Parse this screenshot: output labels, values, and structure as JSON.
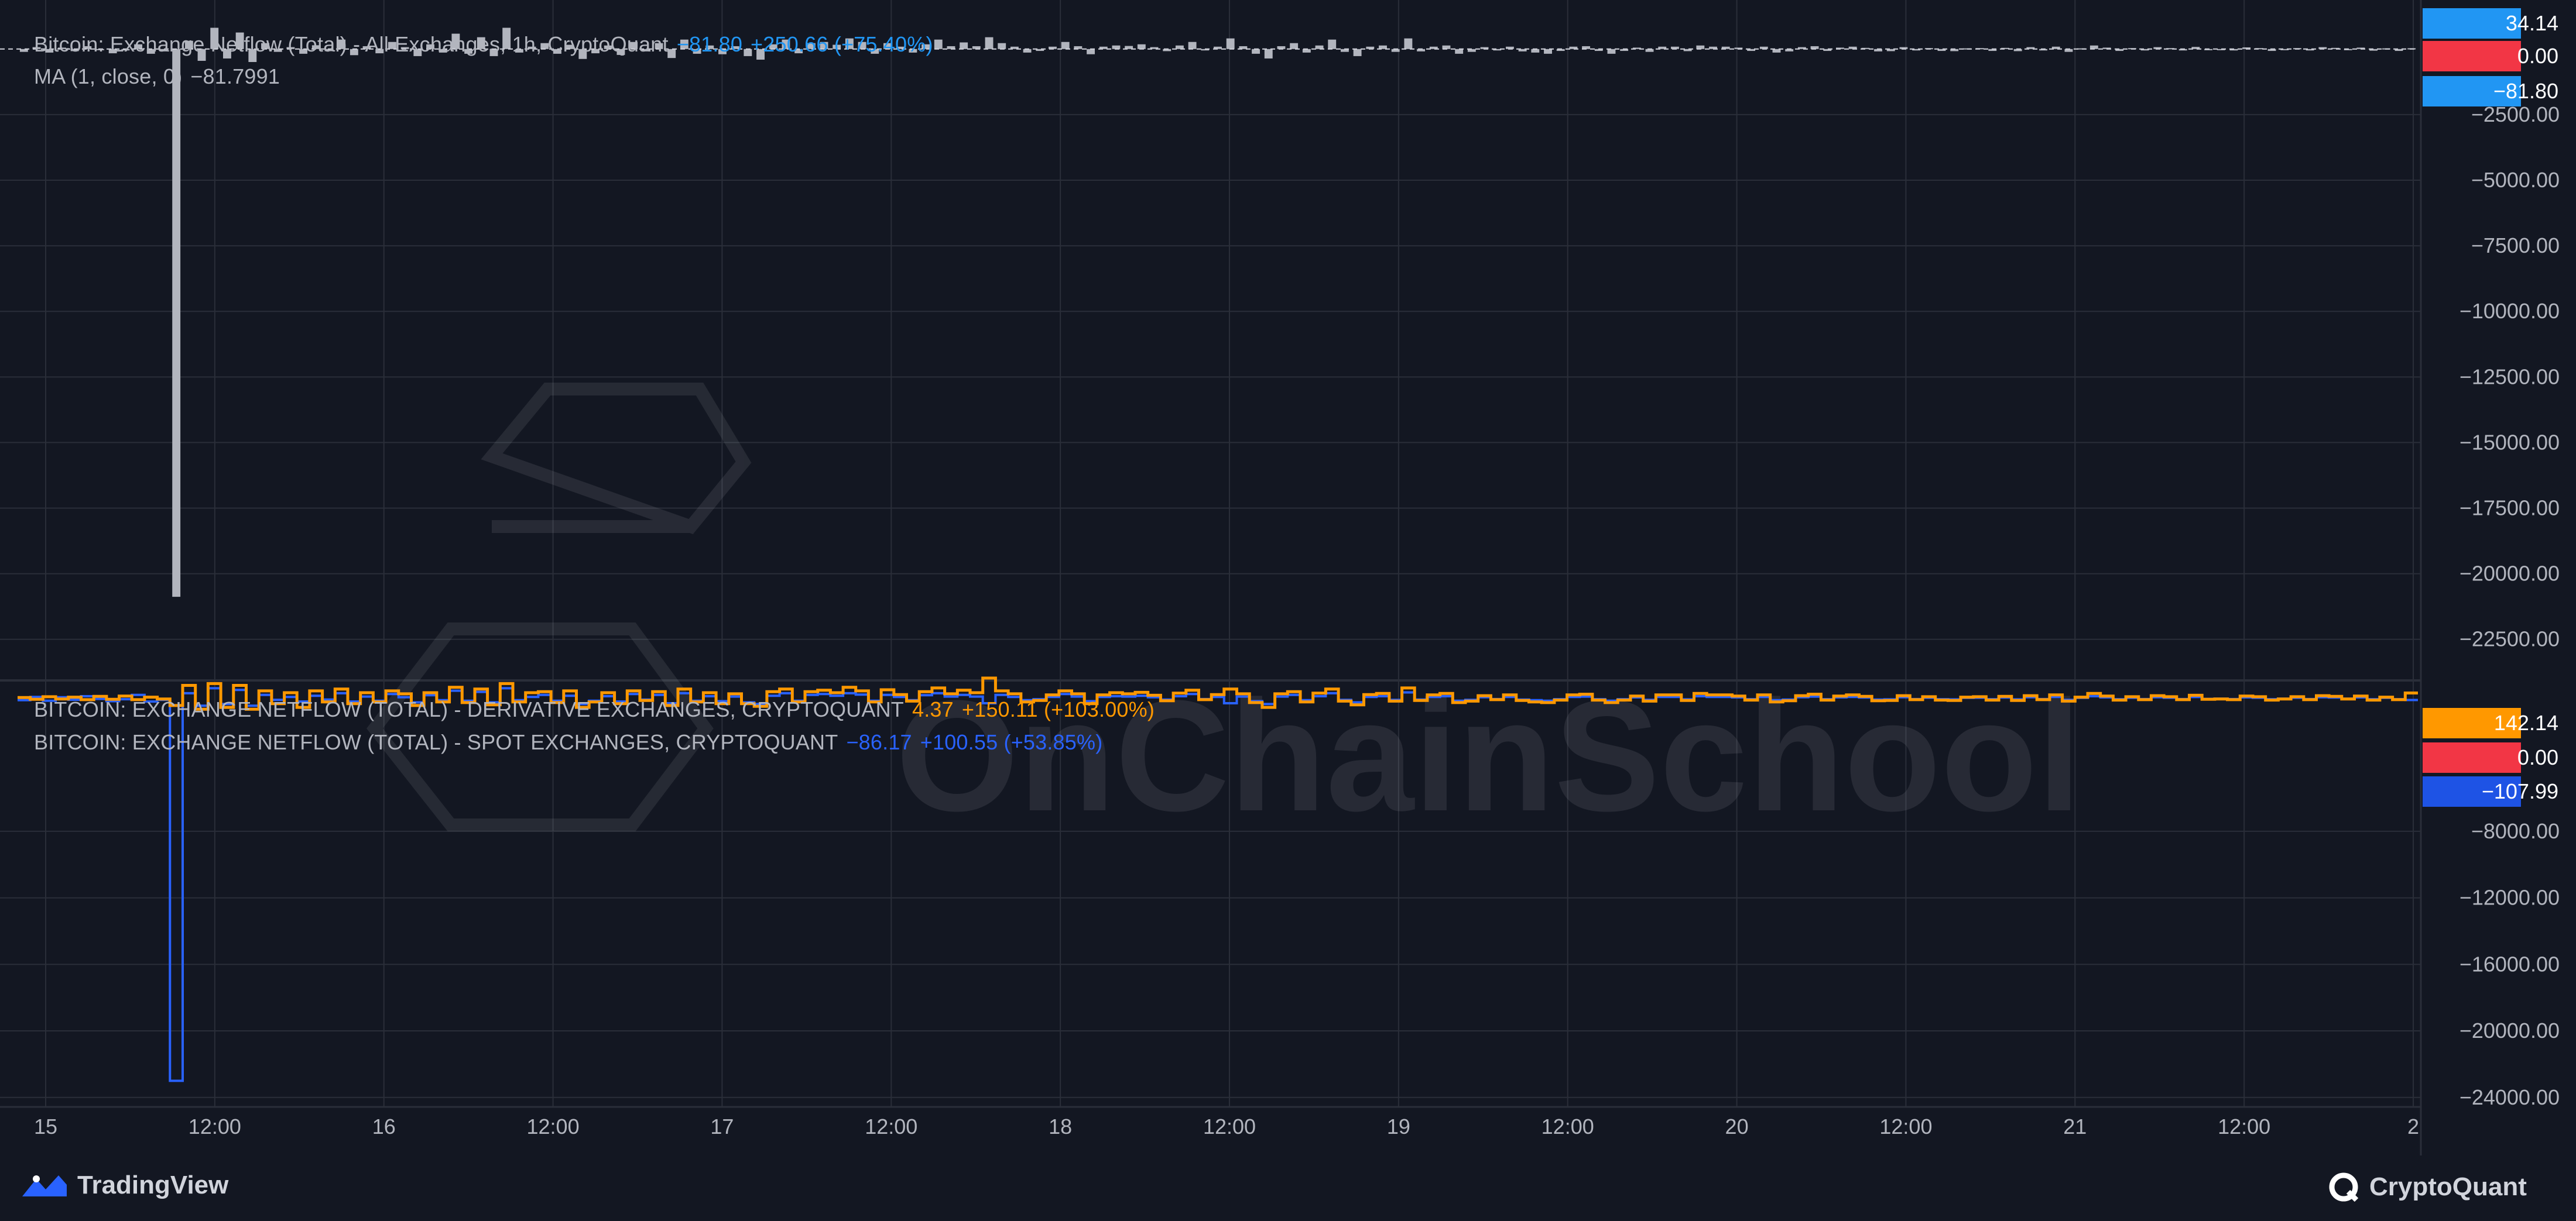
{
  "header": {
    "main_title": "Bitcoin: Exchange Netflow (Total) - All Exchanges, 1h, CryptoQuant",
    "main_last": "−81.80",
    "main_change": "+250.66 (+75.40%)",
    "ma_label": "MA (1, close, 0)",
    "ma_value": "−81.7991"
  },
  "sub_legend": {
    "derivative_title": "BITCOIN: EXCHANGE NETFLOW (TOTAL) - DERIVATIVE EXCHANGES, CRYPTOQUANT",
    "derivative_last": "4.37",
    "derivative_change": "+150.11 (+103.00%)",
    "spot_title": "BITCOIN: EXCHANGE NETFLOW (TOTAL) - SPOT EXCHANGES, CRYPTOQUANT",
    "spot_last": "−86.17",
    "spot_change": "+100.55 (+53.85%)"
  },
  "watermark": "OnChainSchool",
  "footer": {
    "left_brand": "TradingView",
    "right_brand": "CryptoQuant"
  },
  "colors": {
    "background": "#131722",
    "grid": "#2a2e39",
    "bars": "#b2b5be",
    "spot": "#2962ff",
    "derivative": "#ff9800",
    "red_tag": "#f23645",
    "blue_tag": "#2196f3"
  },
  "chart_data": [
    {
      "type": "bar",
      "title": "Bitcoin: Exchange Netflow (Total) - All Exchanges, 1h, CryptoQuant",
      "ylim": [
        -24000,
        1200
      ],
      "y_ticks": [
        "−2500.00",
        "−5000.00",
        "−7500.00",
        "−10000.00",
        "−12500.00",
        "−15000.00",
        "−17500.00",
        "−20000.00",
        "−22500.00"
      ],
      "price_tags": [
        {
          "label": "34.14",
          "value": 34.14,
          "color": "#2196f3"
        },
        {
          "label": "0.00",
          "value": 0,
          "color": "#f23645"
        },
        {
          "label": "−81.80",
          "value": -81.8,
          "color": "#2196f3"
        }
      ],
      "series": [
        {
          "values": [
            -120,
            80,
            -150,
            60,
            -90,
            120,
            -40,
            -180,
            -60,
            200,
            -200,
            -100,
            -23200,
            350,
            -500,
            900,
            -400,
            700,
            -550,
            250,
            -120,
            80,
            -200,
            160,
            -90,
            400,
            -260,
            120,
            -180,
            300,
            80,
            -300,
            200,
            -150,
            650,
            -200,
            500,
            -300,
            900,
            -150,
            100,
            250,
            -200,
            180,
            -420,
            -180,
            150,
            -250,
            300,
            -100,
            250,
            -380,
            400,
            -200,
            150,
            -220,
            120,
            -300,
            -450,
            200,
            400,
            -180,
            250,
            300,
            180,
            450,
            300,
            -200,
            250,
            100,
            -150,
            200,
            400,
            120,
            280,
            120,
            500,
            250,
            100,
            -150,
            -80,
            100,
            300,
            120,
            -220,
            100,
            150,
            130,
            200,
            80,
            -90,
            150,
            300,
            -60,
            100,
            450,
            120,
            -200,
            -400,
            120,
            250,
            -150,
            150,
            400,
            -120,
            -300,
            100,
            150,
            -120,
            450,
            -100,
            100,
            150,
            -200,
            -120,
            80,
            -60,
            100,
            -100,
            -150,
            -200,
            -80,
            100,
            120,
            -80,
            -200,
            -80,
            60,
            -120,
            100,
            100,
            -90,
            150,
            100,
            100,
            60,
            -80,
            100,
            -150,
            -100,
            80,
            120,
            -80,
            60,
            100,
            50,
            -100,
            -90,
            80,
            -60,
            40,
            -80,
            -90,
            30,
            40,
            -80,
            50,
            -90,
            80,
            -60,
            100,
            -120,
            30,
            150,
            60,
            -80,
            40,
            -60,
            80,
            40,
            -60,
            90,
            -50,
            -40,
            -60,
            70,
            40,
            -80,
            -40,
            40,
            -60,
            80,
            50,
            -40,
            60,
            -70,
            30,
            -80,
            34
          ]
        }
      ]
    },
    {
      "type": "line",
      "title": "BITCOIN: EXCHANGE NETFLOW (TOTAL) - DERIVATIVE EXCHANGES / SPOT EXCHANGES, CRYPTOQUANT",
      "ylim": [
        -24500,
        1000
      ],
      "y_ticks": [
        "−8000.00",
        "−12000.00",
        "−16000.00",
        "−20000.00",
        "−24000.00"
      ],
      "price_tags": [
        {
          "label": "142.14",
          "value": 142.14,
          "color": "#ff9800"
        },
        {
          "label": "0.00",
          "value": 0,
          "color": "#f23645"
        },
        {
          "label": "−107.99",
          "value": -107.99,
          "color": "#1e53e5"
        }
      ],
      "x_labels": [
        "15",
        "12:00",
        "16",
        "12:00",
        "17",
        "12:00",
        "18",
        "12:00",
        "19",
        "12:00",
        "20",
        "12:00",
        "21",
        "12:00",
        "2"
      ],
      "series": [
        {
          "name": "DERIVATIVE EXCHANGES",
          "color": "#ff9800"
        },
        {
          "name": "SPOT EXCHANGES",
          "color": "#2962ff"
        }
      ],
      "spot_values": [
        -120,
        80,
        -150,
        60,
        -90,
        120,
        -40,
        -180,
        -60,
        200,
        -200,
        -100,
        -23000,
        300,
        -450,
        600,
        -350,
        500,
        -450,
        200,
        -100,
        80,
        -200,
        150,
        -80,
        300,
        -200,
        100,
        -150,
        250,
        60,
        -250,
        180,
        -120,
        450,
        -150,
        380,
        -250,
        600,
        -120,
        80,
        200,
        -150,
        150,
        -350,
        -150,
        120,
        -200,
        250,
        -80,
        200,
        -300,
        300,
        -150,
        120,
        -180,
        100,
        -250,
        -350,
        150,
        300,
        -150,
        200,
        250,
        150,
        300,
        220,
        -150,
        200,
        80,
        -120,
        180,
        300,
        100,
        200,
        100,
        -300,
        200,
        80,
        -120,
        -60,
        80,
        250,
        100,
        -180,
        80,
        120,
        100,
        150,
        60,
        -80,
        120,
        250,
        -50,
        80,
        -300,
        100,
        -180,
        -350,
        100,
        200,
        -120,
        120,
        300,
        -100,
        -250,
        80,
        120,
        -100,
        350,
        -80,
        80,
        120,
        -150,
        -100,
        60,
        -50,
        80,
        -80,
        -120,
        -150,
        -60,
        80,
        100,
        -60,
        -150,
        -60,
        50,
        -100,
        80,
        80,
        -70,
        120,
        80,
        80,
        50,
        -60,
        80,
        -120,
        -80,
        60,
        100,
        -60,
        50,
        80,
        40,
        -80,
        -70,
        60,
        -50,
        30,
        -60,
        -70,
        25,
        30,
        -60,
        40,
        -70,
        60,
        -50,
        80,
        -100,
        25,
        120,
        50,
        -60,
        30,
        -50,
        60,
        30,
        -50,
        70,
        -40,
        -30,
        -50,
        50,
        30,
        -60,
        -30,
        30,
        -50,
        60,
        40,
        -30,
        50,
        -60,
        25,
        -60,
        -108
      ],
      "derivative_values": [
        20,
        -30,
        40,
        -20,
        30,
        -40,
        50,
        -30,
        60,
        -40,
        30,
        -20,
        -200,
        350,
        -300,
        400,
        -250,
        350,
        -300,
        200,
        -150,
        150,
        -250,
        200,
        -100,
        250,
        -150,
        150,
        -100,
        200,
        120,
        -200,
        150,
        -100,
        300,
        -120,
        250,
        -180,
        400,
        -100,
        150,
        180,
        -120,
        200,
        -250,
        -100,
        150,
        -150,
        200,
        -60,
        180,
        -200,
        250,
        -100,
        150,
        -150,
        120,
        -150,
        -220,
        180,
        250,
        -100,
        180,
        220,
        150,
        300,
        200,
        -100,
        230,
        100,
        -80,
        180,
        280,
        120,
        220,
        150,
        550,
        200,
        120,
        -100,
        -60,
        90,
        200,
        120,
        -150,
        90,
        150,
        120,
        160,
        80,
        -70,
        140,
        220,
        -40,
        100,
        250,
        120,
        -120,
        -250,
        120,
        180,
        -100,
        140,
        250,
        -80,
        -180,
        100,
        130,
        -80,
        280,
        -60,
        90,
        130,
        -120,
        -80,
        70,
        -40,
        90,
        -60,
        -100,
        -120,
        -50,
        90,
        110,
        -50,
        -120,
        -50,
        60,
        -80,
        90,
        90,
        -60,
        130,
        90,
        90,
        60,
        -50,
        90,
        -100,
        -70,
        70,
        110,
        -50,
        60,
        90,
        50,
        -70,
        -60,
        70,
        -40,
        40,
        -50,
        -60,
        30,
        40,
        -50,
        50,
        -60,
        70,
        -40,
        90,
        -80,
        30,
        130,
        60,
        -50,
        40,
        -40,
        70,
        40,
        -40,
        80,
        -30,
        -20,
        -40,
        60,
        40,
        -50,
        -20,
        40,
        -40,
        70,
        50,
        -20,
        60,
        -50,
        30,
        -40,
        142
      ]
    }
  ]
}
